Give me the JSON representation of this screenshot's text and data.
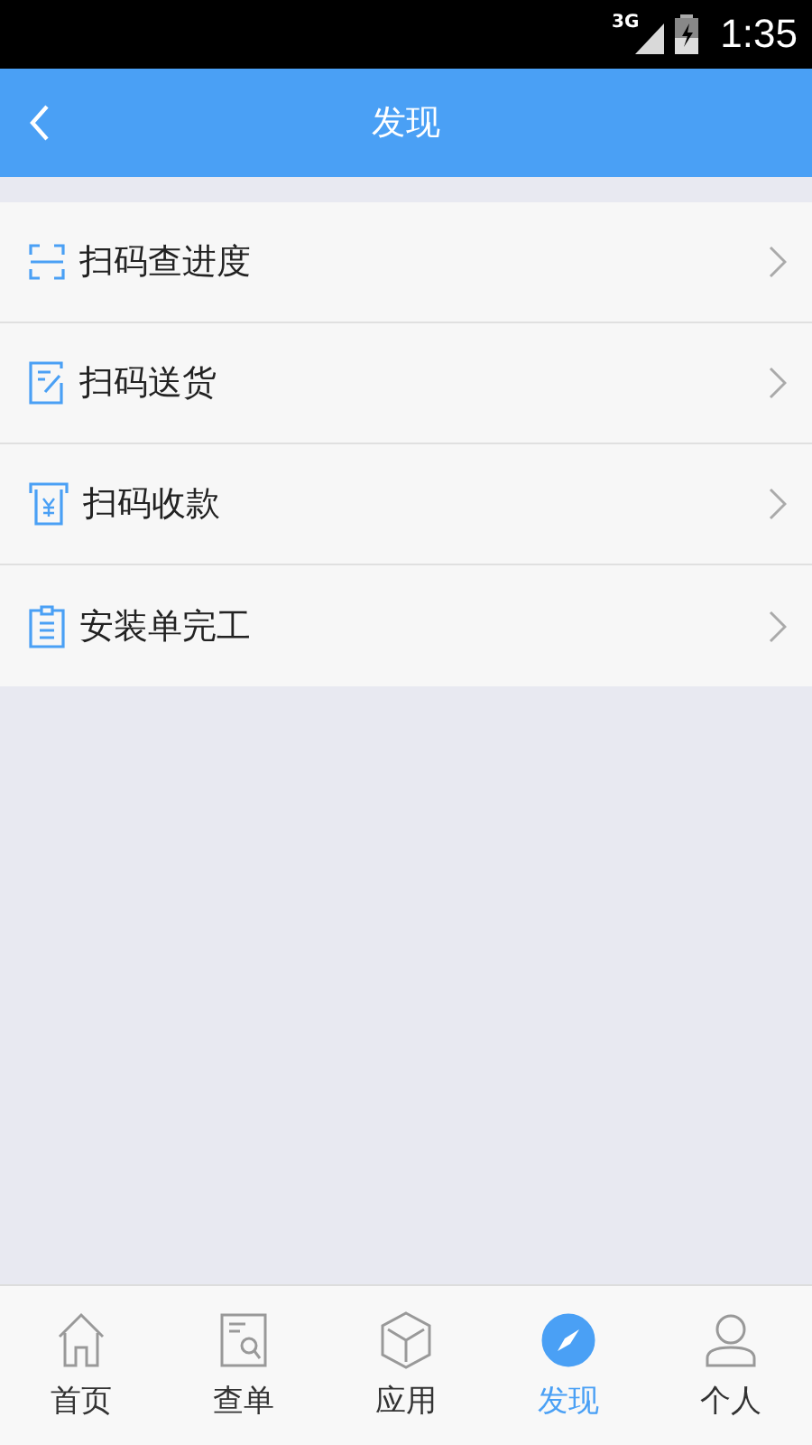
{
  "status_bar": {
    "network": "3G",
    "time": "1:35"
  },
  "header": {
    "title": "发现"
  },
  "menu": [
    {
      "kind": "scan",
      "label": "扫码查进度"
    },
    {
      "kind": "edit",
      "label": "扫码送货"
    },
    {
      "kind": "receipt",
      "label": "扫码收款"
    },
    {
      "kind": "clipboard",
      "label": "安装单完工"
    }
  ],
  "tabs": [
    {
      "kind": "home",
      "label": "首页",
      "selected": false
    },
    {
      "kind": "document",
      "label": "查单",
      "selected": false
    },
    {
      "kind": "cube",
      "label": "应用",
      "selected": false
    },
    {
      "kind": "compass",
      "label": "发现",
      "selected": true
    },
    {
      "kind": "person",
      "label": "个人",
      "selected": false
    }
  ]
}
